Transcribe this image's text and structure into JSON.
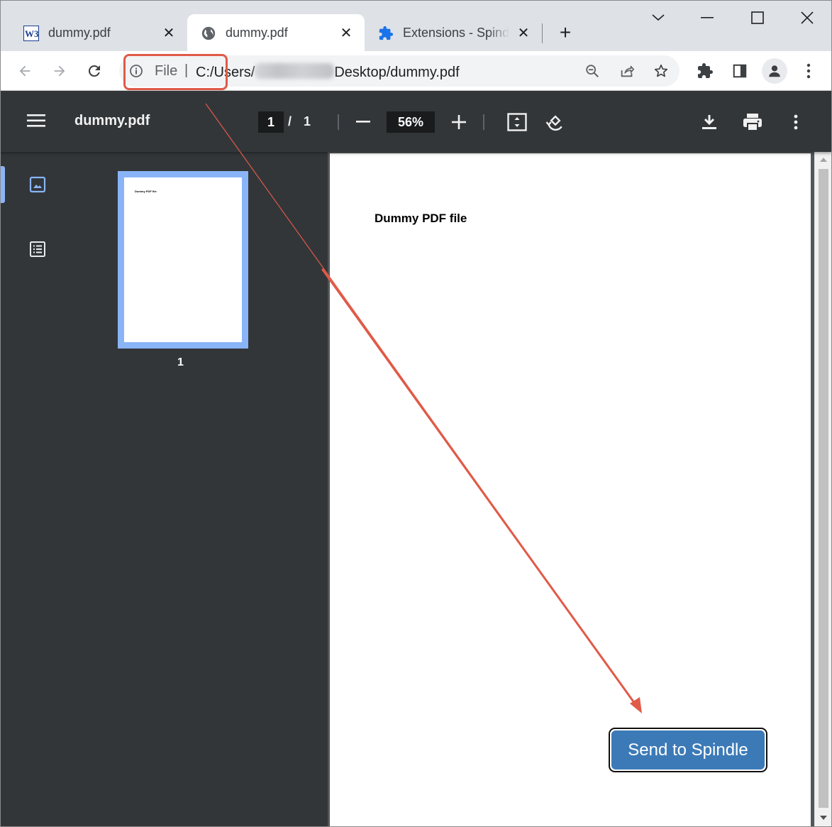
{
  "tabs": [
    {
      "favicon": "w3schools-icon",
      "title": "dummy.pdf",
      "close": "✕"
    },
    {
      "favicon": "globe-icon",
      "title": "dummy.pdf",
      "close": "✕",
      "active": true
    },
    {
      "favicon": "extension-puzzle-icon",
      "title": "Extensions - Spindle",
      "close": "✕"
    }
  ],
  "new_tab_label": "+",
  "window_controls": [
    "tab-search-icon",
    "minimize-icon",
    "maximize-icon",
    "close-icon"
  ],
  "omnibox": {
    "scheme": "File",
    "separator": "|",
    "path_prefix": "C:/Users/",
    "path_suffix": "Desktop/dummy.pdf",
    "redacted_username": true
  },
  "toolbar_icons": [
    "back-icon",
    "forward-icon",
    "reload-icon",
    "zoom-icon",
    "share-icon",
    "bookmark-star-icon",
    "extensions-icon",
    "side-panel-icon",
    "profile-avatar-icon",
    "menu-icon"
  ],
  "pdf_viewer": {
    "title": "dummy.pdf",
    "current_page": "1",
    "page_slash": "/",
    "total_pages": "1",
    "zoom": "56%",
    "thumbnail_label": "1",
    "thumbnail_text": "Dummy PDF file",
    "document_heading": "Dummy PDF file"
  },
  "extension_button": {
    "label": "Send to Spindle",
    "color": "#3c7ab7"
  },
  "annotation": {
    "color": "#e05a48",
    "shapes": [
      "highlight-rectangle",
      "arrow"
    ]
  },
  "colors": {
    "tabstrip": "#dee1e6",
    "pdf_toolbar": "#323639",
    "thumbnail_border": "#8ab4f8"
  }
}
